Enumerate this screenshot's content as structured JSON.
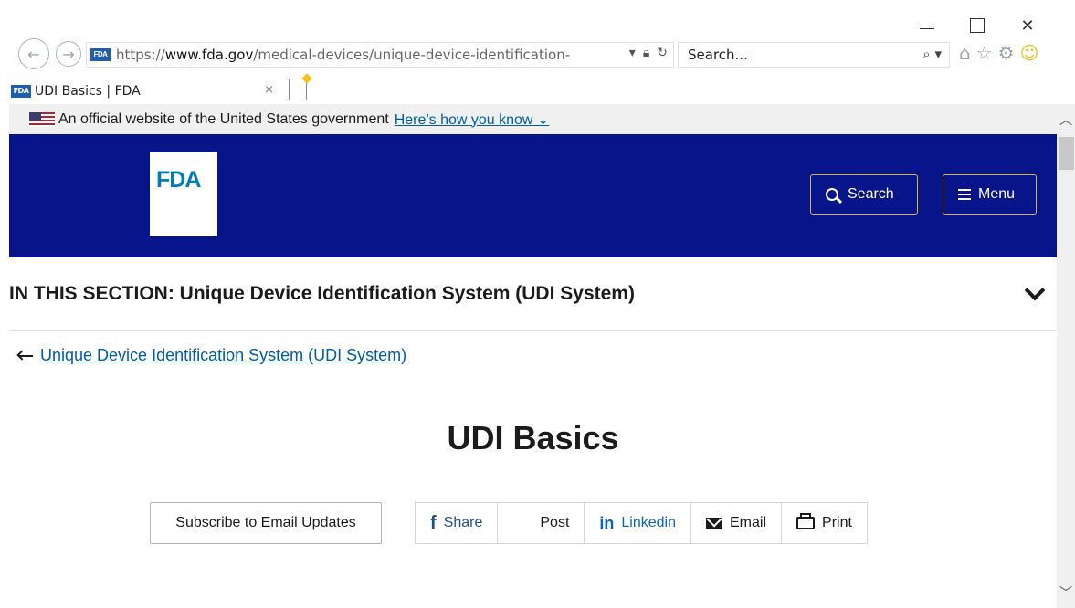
{
  "window": {
    "minimize_icon": "minimize-icon",
    "maximize_icon": "maximize-icon",
    "close_glyph": "✕"
  },
  "browser": {
    "favicon_text": "FDA",
    "url_prefix": "https://",
    "url_domain": "www.fda.gov",
    "url_path": "/medical-devices/unique-device-identification-",
    "search_placeholder": "Search...",
    "tab_title": "UDI Basics | FDA",
    "tab_close": "×"
  },
  "gov_banner": {
    "text": "An official website of the United States government",
    "link": "Here’s how you know"
  },
  "header": {
    "logo": "FDA",
    "search_button": "Search",
    "menu_button": "Menu",
    "accent_color": "#07148a"
  },
  "section": {
    "title": "IN THIS SECTION: Unique Device Identification System (UDI System)"
  },
  "back_link": "Unique Device Identification System (UDI System)",
  "page_title": "UDI Basics",
  "actions": {
    "subscribe": "Subscribe to Email Updates",
    "share": "Share",
    "post": "Post",
    "linkedin": "Linkedin",
    "email": "Email",
    "print": "Print"
  }
}
